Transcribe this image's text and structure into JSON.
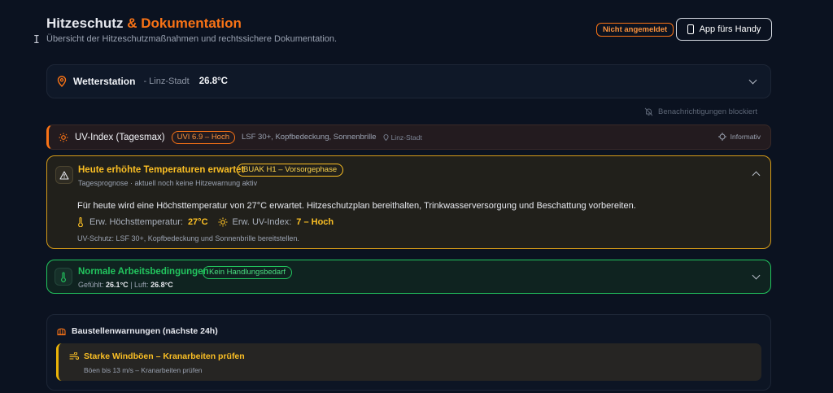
{
  "header": {
    "title_main": "Hitzeschutz",
    "title_accent": "& Dokumentation",
    "subtitle": "Übersicht der Hitzeschutzmaßnahmen und rechtssichere Dokumentation.",
    "login_badge": "Nicht angemeldet",
    "app_button": "App fürs Handy"
  },
  "weather": {
    "name": "Wetterstation",
    "location": "- Linz-Stadt",
    "temperature": "26.8°C"
  },
  "notifications": {
    "label": "Benachrichtigungen blockiert"
  },
  "uv": {
    "title": "UV-Index (Tagesmax)",
    "badge": "UVI 6.9 – Hoch",
    "recommendation": "LSF 30+, Kopfbedeckung, Sonnenbrille",
    "location": "Linz-Stadt",
    "info": "Informativ"
  },
  "heat": {
    "title": "Heute erhöhte Temperaturen erwartet",
    "badge": "BUAK H1 – Vorsorgephase",
    "subtitle": "Tagesprognose · aktuell noch keine Hitzewarnung aktiv",
    "body": "Für heute wird eine Höchsttemperatur von 27°C erwartet. Hitzeschutzplan bereithalten, Trinkwasserversorgung und Beschattung vorbereiten.",
    "max_label": "Erw. Höchsttemperatur:",
    "max_value": "27°C",
    "uv_label": "Erw. UV-Index:",
    "uv_value": "7 – Hoch",
    "note": "UV-Schutz: LSF 30+, Kopfbedeckung und Sonnenbrille bereitstellen."
  },
  "normal": {
    "title": "Normale Arbeitsbedingungen",
    "badge": "Kein Handlungsbedarf",
    "felt_label": "Gefühlt:",
    "felt_value": "26.1°C",
    "separator": "|",
    "air_label": "Luft:",
    "air_value": "26.8°C"
  },
  "site": {
    "title": "Baustellenwarnungen (nächste 24h)",
    "warnings": [
      {
        "title": "Starke Windböen – Kranarbeiten prüfen",
        "detail": "Böen bis 13 m/s – Kranarbeiten prüfen"
      }
    ]
  },
  "icons": {
    "pin": "map-pin-icon",
    "sun": "sun-icon",
    "warning": "warning-triangle-icon",
    "thermometer": "thermometer-icon",
    "bell_off": "bell-off-icon",
    "wind": "wind-icon",
    "site": "construction-icon"
  },
  "colors": {
    "background": "#0b1220",
    "accent": "#f97316",
    "warning": "#fbbf24",
    "ok": "#22c55e"
  }
}
